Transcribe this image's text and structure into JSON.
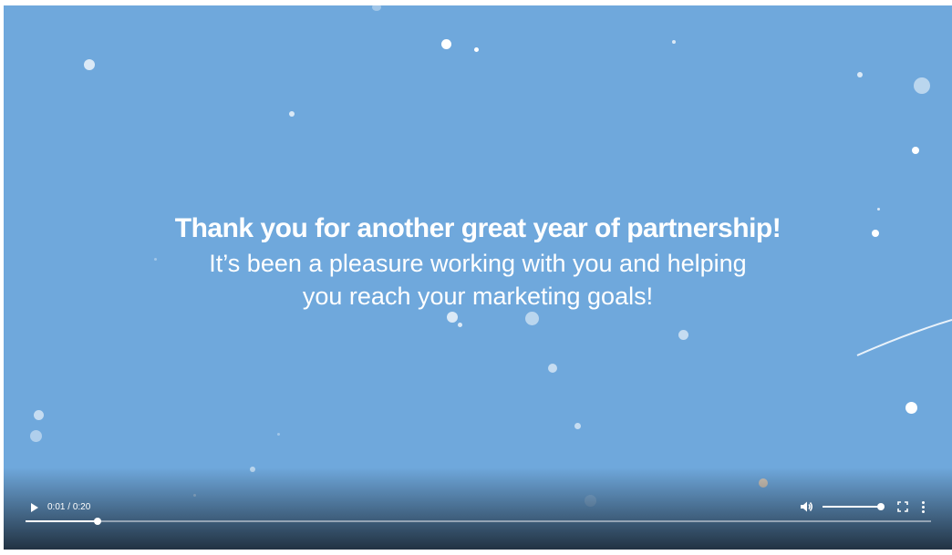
{
  "video": {
    "headline": "Thank you for another great year of partnership!",
    "subtitle_line1": "It’s been a pleasure working with you and helping",
    "subtitle_line2": "you reach your marketing goals!",
    "background_color": "#6fa8dc"
  },
  "controls": {
    "play_icon": "play-icon",
    "current_time": "0:01",
    "separator": " / ",
    "duration": "0:20",
    "progress_fraction": 0.08,
    "volume_icon": "volume-icon",
    "volume_fraction": 0.95,
    "fullscreen_icon": "fullscreen-icon",
    "more_icon": "more-options-icon"
  }
}
